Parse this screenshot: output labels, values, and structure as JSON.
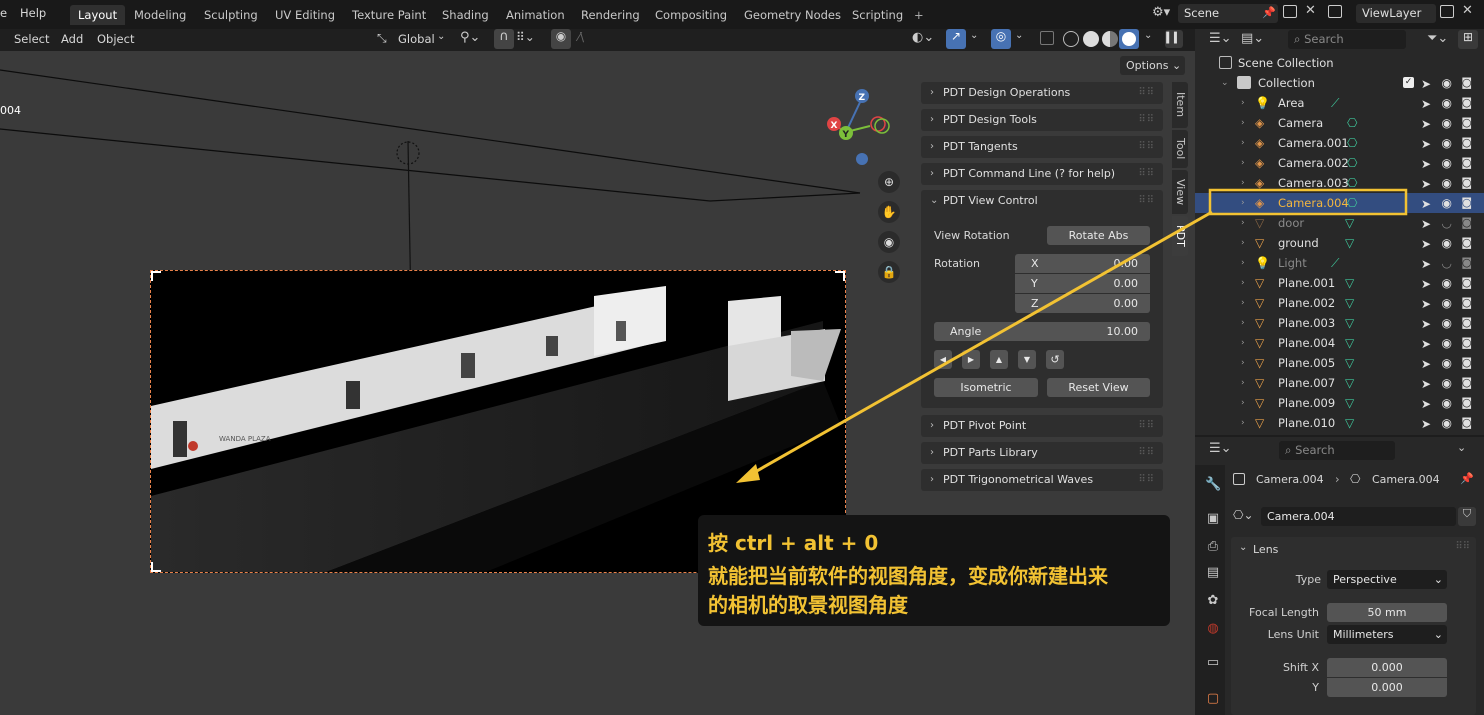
{
  "topbar": {
    "menu": [
      "e",
      "Help"
    ],
    "workspaces": [
      "Layout",
      "Modeling",
      "Sculpting",
      "UV Editing",
      "Texture Paint",
      "Shading",
      "Animation",
      "Rendering",
      "Compositing",
      "Geometry Nodes",
      "Scripting"
    ],
    "add_tab": "+",
    "scene": "Scene",
    "view_layer": "ViewLayer"
  },
  "viewport_header": {
    "menus": [
      "Select",
      "Add",
      "Object"
    ],
    "transform_orientation": "Global",
    "options": "Options"
  },
  "viewport": {
    "object_label": "004",
    "gizmo": {
      "z": "Z",
      "y": "Y",
      "x": "X"
    }
  },
  "npanel": {
    "tabs": [
      "Item",
      "Tool",
      "View",
      "PDT"
    ],
    "panels_top": [
      "PDT Design Operations",
      "PDT Design Tools",
      "PDT Tangents",
      "PDT Command Line (? for help)"
    ],
    "view_control": {
      "title": "PDT View Control",
      "view_rotation_label": "View Rotation",
      "rotate_abs": "Rotate Abs",
      "rotation_label": "Rotation",
      "x_label": "X",
      "x_val": "0.00",
      "y_label": "Y",
      "y_val": "0.00",
      "z_label": "Z",
      "z_val": "0.00",
      "angle_label": "Angle",
      "angle_val": "10.00",
      "isometric": "Isometric",
      "reset_view": "Reset View"
    },
    "panels_bottom": [
      "PDT Pivot Point",
      "PDT Parts Library",
      "PDT Trigonometrical Waves"
    ]
  },
  "outliner": {
    "search_placeholder": "Search",
    "scene_collection": "Scene Collection",
    "collection": "Collection",
    "items": [
      {
        "name": "Area",
        "type": "light"
      },
      {
        "name": "Camera",
        "type": "camera"
      },
      {
        "name": "Camera.001",
        "type": "camera"
      },
      {
        "name": "Camera.002",
        "type": "camera"
      },
      {
        "name": "Camera.003",
        "type": "camera"
      },
      {
        "name": "Camera.004",
        "type": "camera",
        "selected": true
      },
      {
        "name": "door",
        "type": "mesh",
        "hidden": true
      },
      {
        "name": "ground",
        "type": "mesh"
      },
      {
        "name": "Light",
        "type": "light",
        "hidden": true
      },
      {
        "name": "Plane.001",
        "type": "mesh"
      },
      {
        "name": "Plane.002",
        "type": "mesh"
      },
      {
        "name": "Plane.003",
        "type": "mesh"
      },
      {
        "name": "Plane.004",
        "type": "mesh"
      },
      {
        "name": "Plane.005",
        "type": "mesh"
      },
      {
        "name": "Plane.007",
        "type": "mesh"
      },
      {
        "name": "Plane.009",
        "type": "mesh"
      },
      {
        "name": "Plane.010",
        "type": "mesh"
      }
    ]
  },
  "properties": {
    "search_placeholder": "Search",
    "breadcrumb_object": "Camera.004",
    "breadcrumb_data": "Camera.004",
    "datablock": "Camera.004",
    "lens_section": "Lens",
    "type_label": "Type",
    "type_val": "Perspective",
    "focal_label": "Focal Length",
    "focal_val": "50 mm",
    "lens_unit_label": "Lens Unit",
    "lens_unit_val": "Millimeters",
    "shift_x_label": "Shift X",
    "shift_x_val": "0.000",
    "shift_y_label": "Y",
    "shift_y_val": "0.000"
  },
  "annotation": {
    "line1": "按 ctrl + alt + 0",
    "line2": "就能把当前软件的视图角度，变成你新建出来",
    "line3": "的相机的取景视图角度"
  },
  "colors": {
    "accent_blue": "#4772b3",
    "annotation_yellow": "#f2c233",
    "camera_orange": "#e0954a",
    "mesh_orange": "#e8a04a",
    "data_green": "#3fc79b"
  }
}
